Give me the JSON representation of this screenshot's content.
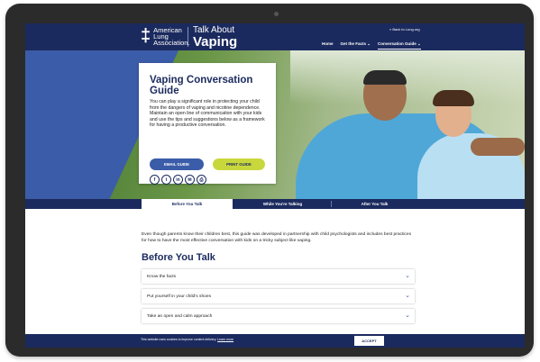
{
  "header": {
    "logo_name": "American Lung Association.",
    "title_small": "Talk About",
    "title_big": "Vaping",
    "back_link": "« Back to Lung.org",
    "nav": [
      "Home",
      "Get the Facts ⌄",
      "Conversation Guide ⌄"
    ]
  },
  "card": {
    "title": "Vaping Conversation Guide",
    "text": "You can play a significant role in protecting your child from the dangers of vaping and nicotine dependence. Maintain an open line of communication with your kids and use the tips and suggestions below as a framework for having a productive conversation.",
    "email_button": "EMAIL GUIDE",
    "print_button": "PRINT GUIDE",
    "socials": [
      "f",
      "t",
      "in",
      "✉",
      "⎙"
    ]
  },
  "tabs": [
    "Before You Talk",
    "While You're Talking",
    "After You Talk"
  ],
  "intro": "Even though parents know their children best, this guide was developed in partnership with child psychologists and includes best practices for how to have the most effective conversation with kids on a tricky subject like vaping.",
  "section_title": "Before You Talk",
  "accordion": [
    "Know the facts",
    "Put yourself in your child's shoes",
    "Take an open and calm approach"
  ],
  "cookie": {
    "text": "This website uses cookies to improve content delivery.",
    "link": "Learn more",
    "accept": "ACCEPT"
  },
  "colors": {
    "navy": "#1b2a5e",
    "blue": "#3b5ca8",
    "lime": "#c8d83c"
  }
}
